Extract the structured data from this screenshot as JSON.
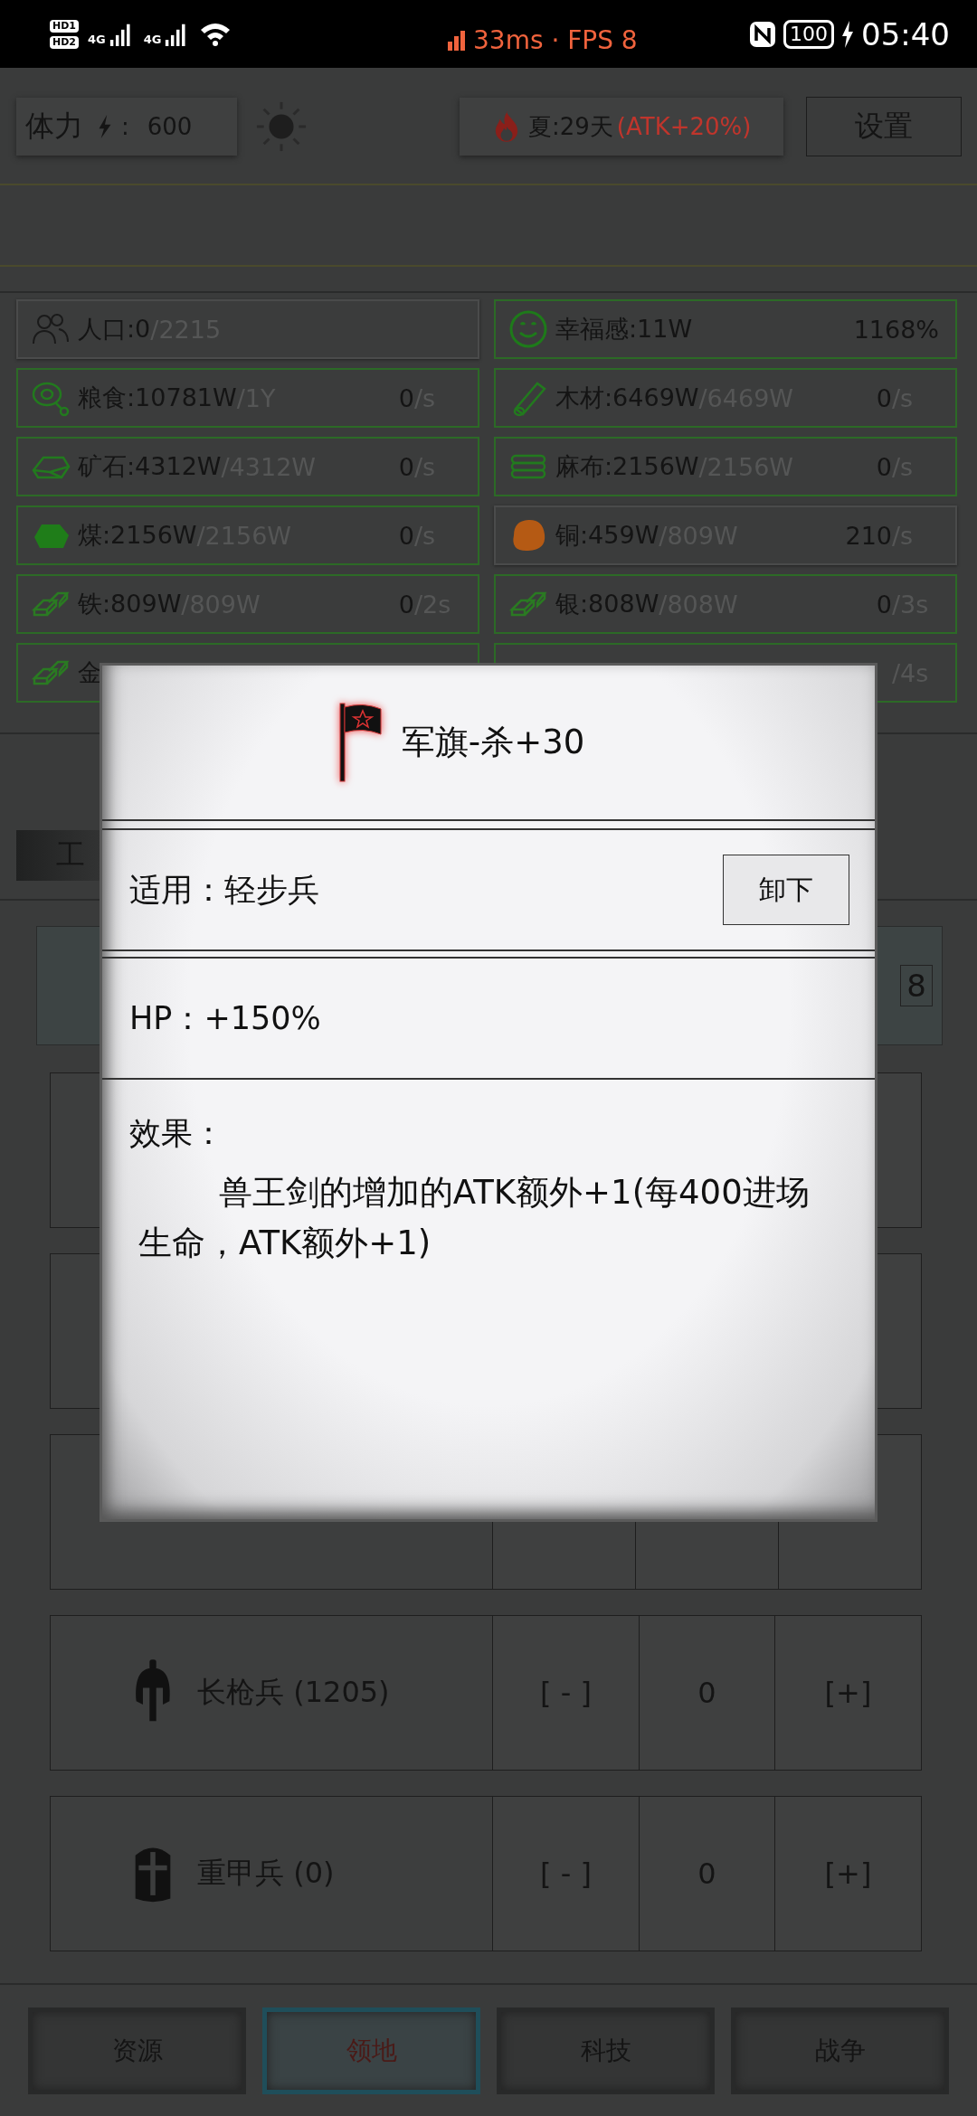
{
  "status_bar": {
    "sims": [
      "HD1",
      "HD2"
    ],
    "networks": [
      "4G",
      "4G"
    ],
    "perf": "33ms · FPS 8",
    "battery": "100",
    "time": "05:40"
  },
  "header": {
    "stamina_label": "体力",
    "stamina_sep": ":",
    "stamina_value": "600",
    "season": "夏:29天",
    "season_bonus": "(ATK+20%)",
    "settings": "设置"
  },
  "resources": [
    {
      "kind": "people",
      "label": "人口:0",
      "cap": "/2215",
      "color": "#4a4b4b"
    },
    {
      "kind": "smile",
      "label": "幸福感:11W",
      "rate": "1168%",
      "color": "#2c6a26"
    },
    {
      "kind": "meat",
      "label": "粮食:10781W",
      "cap": "/1Y",
      "rate": "0",
      "rate_unit": "/s",
      "color": "#2c6a26"
    },
    {
      "kind": "log",
      "label": "木材:6469W",
      "cap": "/6469W",
      "rate": "0",
      "rate_unit": "/s",
      "color": "#2c6a26"
    },
    {
      "kind": "ore",
      "label": "矿石:4312W",
      "cap": "/4312W",
      "rate": "0",
      "rate_unit": "/s",
      "color": "#2c6a26"
    },
    {
      "kind": "cloth",
      "label": "麻布:2156W",
      "cap": "/2156W",
      "rate": "0",
      "rate_unit": "/s",
      "color": "#2c6a26"
    },
    {
      "kind": "coal",
      "label": "煤:2156W",
      "cap": "/2156W",
      "rate": "0",
      "rate_unit": "/s",
      "color": "#2c6a26"
    },
    {
      "kind": "copper",
      "label": "铜:459W",
      "cap": "/809W",
      "rate": "210",
      "rate_unit": "/s",
      "color": "#4a4b4b"
    },
    {
      "kind": "ingot",
      "label": "铁:809W",
      "cap": "/809W",
      "rate": "0",
      "rate_unit": "/2s",
      "color": "#2c6a26"
    },
    {
      "kind": "ingot",
      "label": "银:808W",
      "cap": "/808W",
      "rate": "0",
      "rate_unit": "/3s",
      "color": "#2c6a26"
    },
    {
      "kind": "ingot",
      "label": "金",
      "color": "#2c6a26"
    },
    {
      "kind": "blank",
      "rate_unit": "/4s",
      "color": "#2c6a26"
    }
  ],
  "workers_tab": "工",
  "counter_value": "8",
  "units": [
    {
      "kind": "covered"
    },
    {
      "kind": "covered"
    },
    {
      "kind": "covered"
    },
    {
      "kind": "spearman",
      "name": "长枪兵 (1205)",
      "minus": "[ - ]",
      "count": "0",
      "plus": "[+]"
    },
    {
      "kind": "heavy",
      "name": "重甲兵 (0)",
      "minus": "[ - ]",
      "count": "0",
      "plus": "[+]"
    }
  ],
  "nav": [
    {
      "label": "资源",
      "selected": false
    },
    {
      "label": "领地",
      "selected": true
    },
    {
      "label": "科技",
      "selected": false
    },
    {
      "label": "战争",
      "selected": false
    }
  ],
  "dialog": {
    "title": "军旗-杀+30",
    "applies": "适用：轻步兵",
    "unequip": "卸下",
    "hp": "HP：+150%",
    "effect_label": "效果：",
    "effect_text": "兽王剑的增加的ATK额外+1(每400进场生命，ATK额外+1)"
  }
}
